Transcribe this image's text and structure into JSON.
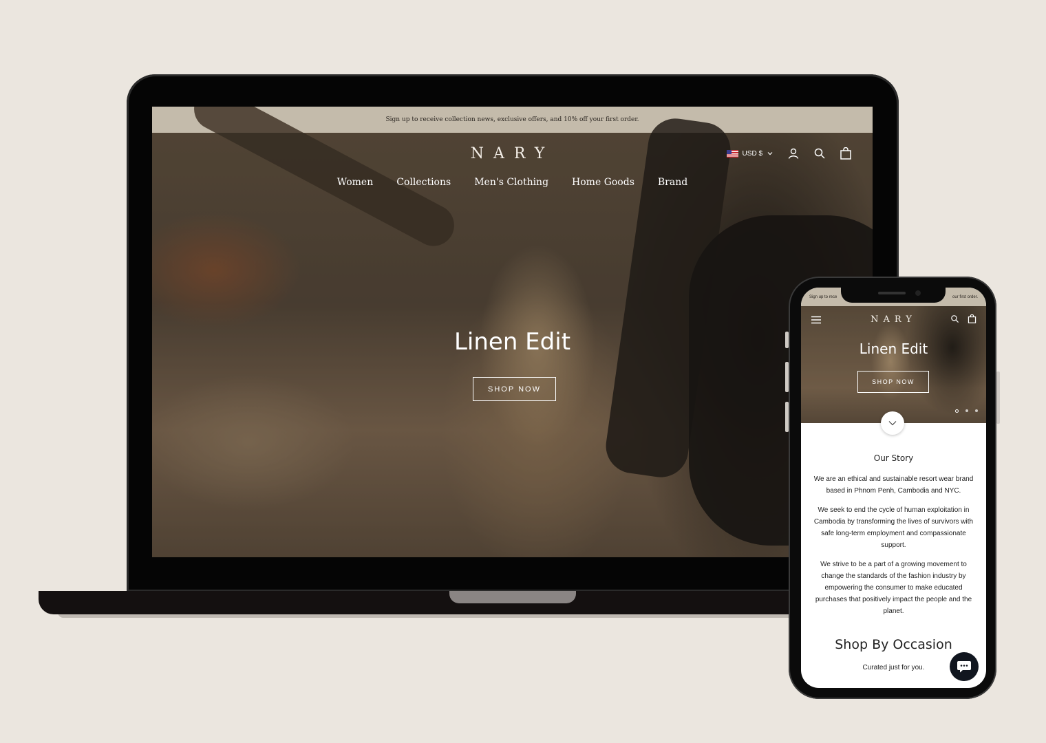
{
  "desktop": {
    "promo": "Sign up to receive collection news, exclusive offers, and 10% off your first order.",
    "logo": "NARY",
    "nav": [
      "Women",
      "Collections",
      "Men's Clothing",
      "Home Goods",
      "Brand"
    ],
    "currency": "USD $",
    "hero_title": "Linen Edit",
    "hero_button": "SHOP NOW"
  },
  "mobile": {
    "promo_left": "Sign up to rece",
    "promo_right": "our first order.",
    "logo": "NARY",
    "hero_title": "Linen Edit",
    "hero_button": "SHOP NOW",
    "story_title": "Our Story",
    "story_paragraphs": [
      "We are an ethical and sustainable resort wear brand based in Phnom Penh, Cambodia and NYC.",
      "We seek to end the cycle of human exploitation in Cambodia by transforming the lives of survivors with safe long-term employment and compassionate support.",
      "We strive to be a part of a growing movement to change the standards of the fashion industry by empowering the consumer to make educated purchases that positively impact the people and the planet."
    ],
    "occasion_title": "Shop By Occasion",
    "occasion_sub": "Curated just for you."
  },
  "colors": {
    "background": "#ebe6df",
    "promo_bar": "#c4bbab",
    "device_frame": "#050505",
    "chat": "#11161f"
  },
  "icons": [
    "flag-us-icon",
    "chevron-down-icon",
    "account-icon",
    "search-icon",
    "bag-icon",
    "menu-icon",
    "chat-icon"
  ]
}
